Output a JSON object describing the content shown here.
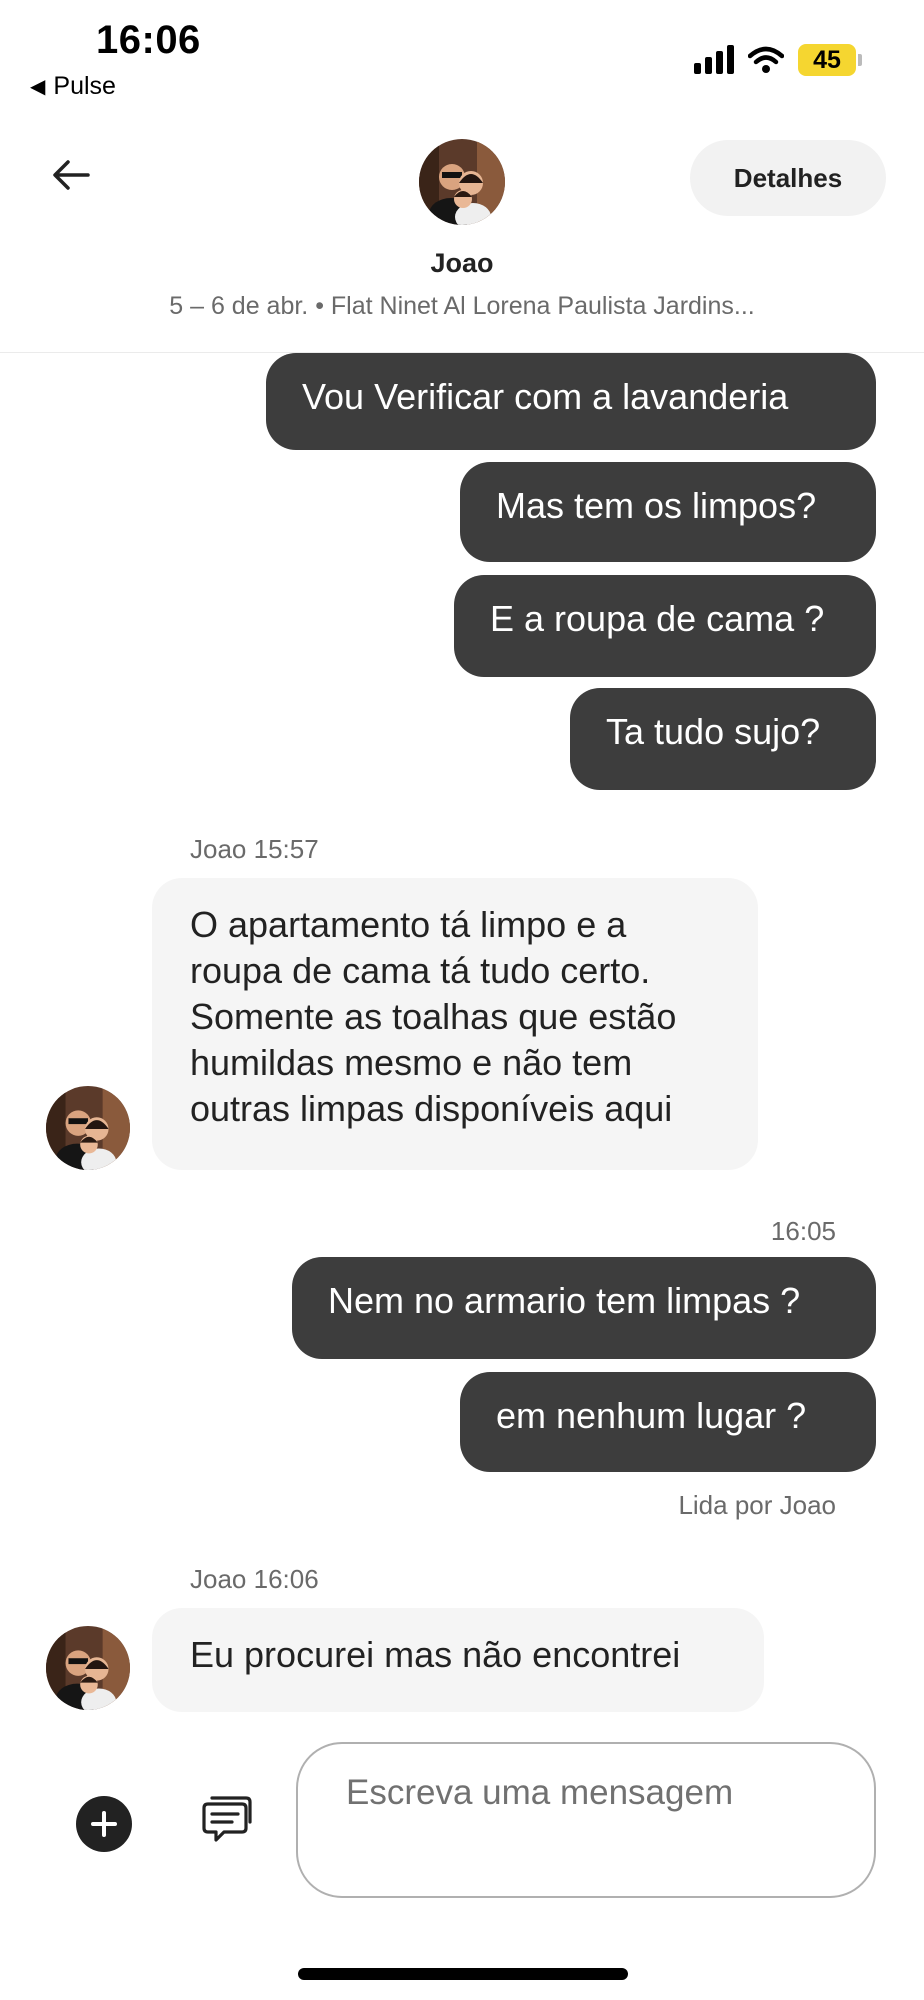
{
  "status_bar": {
    "time": "16:06",
    "back_app": "Pulse",
    "battery": "45",
    "battery_color": "#f5d630"
  },
  "header": {
    "back_icon": "arrow-left-icon",
    "details_label": "Detalhes",
    "host_name": "Joao",
    "trip_info": "5 – 6 de abr. • Flat Ninet Al Lorena Paulista Jardins..."
  },
  "messages": {
    "out_1": "Vou Verificar com a lavanderia",
    "out_2": "Mas tem os limpos?",
    "out_3": "E a roupa de cama ?",
    "out_4": "Ta tudo sujo?",
    "in_1_meta": "Joao 15:57",
    "in_1_lines": [
      "O apartamento tá limpo e a",
      "roupa de cama tá tudo certo.",
      "Somente as toalhas que estão",
      "humildas mesmo e não tem",
      "outras limpas disponíveis aqui"
    ],
    "out_time": "16:05",
    "out_5": "Nem no armario tem limpas ?",
    "out_6": "em nenhum lugar ?",
    "read_receipt": "Lida por Joao",
    "in_2_meta": "Joao 16:06",
    "in_2": "Eu procurei mas não encontrei"
  },
  "composer": {
    "placeholder": "Escreva uma mensagem",
    "add_icon": "plus-circle-icon",
    "templates_icon": "chat-templates-icon"
  },
  "colors": {
    "outgoing_bubble": "#3d3d3d",
    "incoming_bubble": "#f5f5f5",
    "muted_text": "#6a6a6a"
  }
}
